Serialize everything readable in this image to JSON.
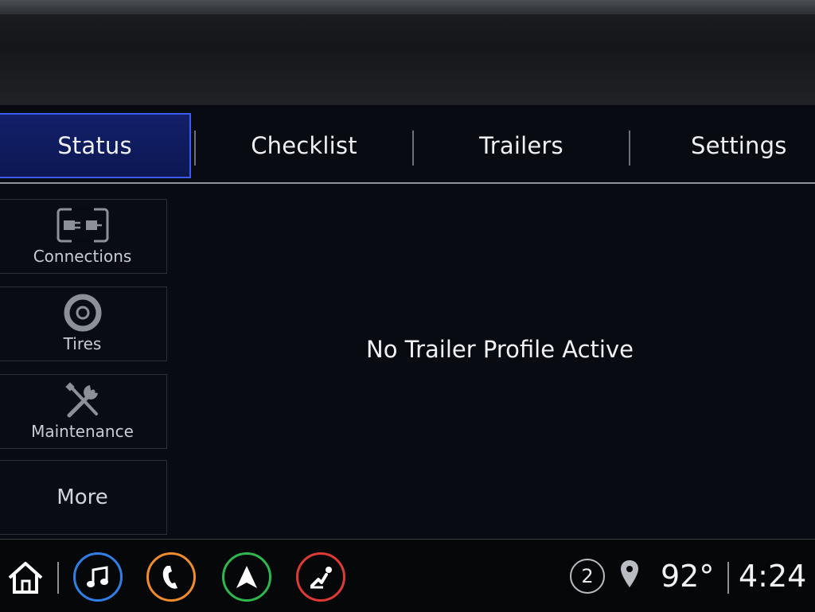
{
  "tabs": [
    {
      "label": "Status",
      "active": true
    },
    {
      "label": "Checklist",
      "active": false
    },
    {
      "label": "Trailers",
      "active": false
    },
    {
      "label": "Settings",
      "active": false
    }
  ],
  "sidebar": {
    "items": [
      {
        "label": "Connections",
        "icon": "connections-icon"
      },
      {
        "label": "Tires",
        "icon": "tire-icon"
      },
      {
        "label": "Maintenance",
        "icon": "wrench-screwdriver-icon"
      },
      {
        "label": "More",
        "icon": ""
      }
    ]
  },
  "main": {
    "message": "No Trailer Profile Active"
  },
  "bottom_bar": {
    "apps": [
      {
        "name": "home",
        "icon": "home-icon",
        "color": "#ffffff"
      },
      {
        "name": "audio",
        "icon": "music-note-icon",
        "color": "#2f7fe6"
      },
      {
        "name": "phone",
        "icon": "phone-icon",
        "color": "#f08c2c"
      },
      {
        "name": "navigation",
        "icon": "navigation-arrow-icon",
        "color": "#2fb64e"
      },
      {
        "name": "climate",
        "icon": "seat-heat-icon",
        "color": "#e03a32"
      }
    ],
    "notification_count": "2",
    "temperature": "92°",
    "time": "4:24"
  },
  "colors": {
    "accent_active_tab": "#3b5cf0",
    "background": "#080b12"
  }
}
